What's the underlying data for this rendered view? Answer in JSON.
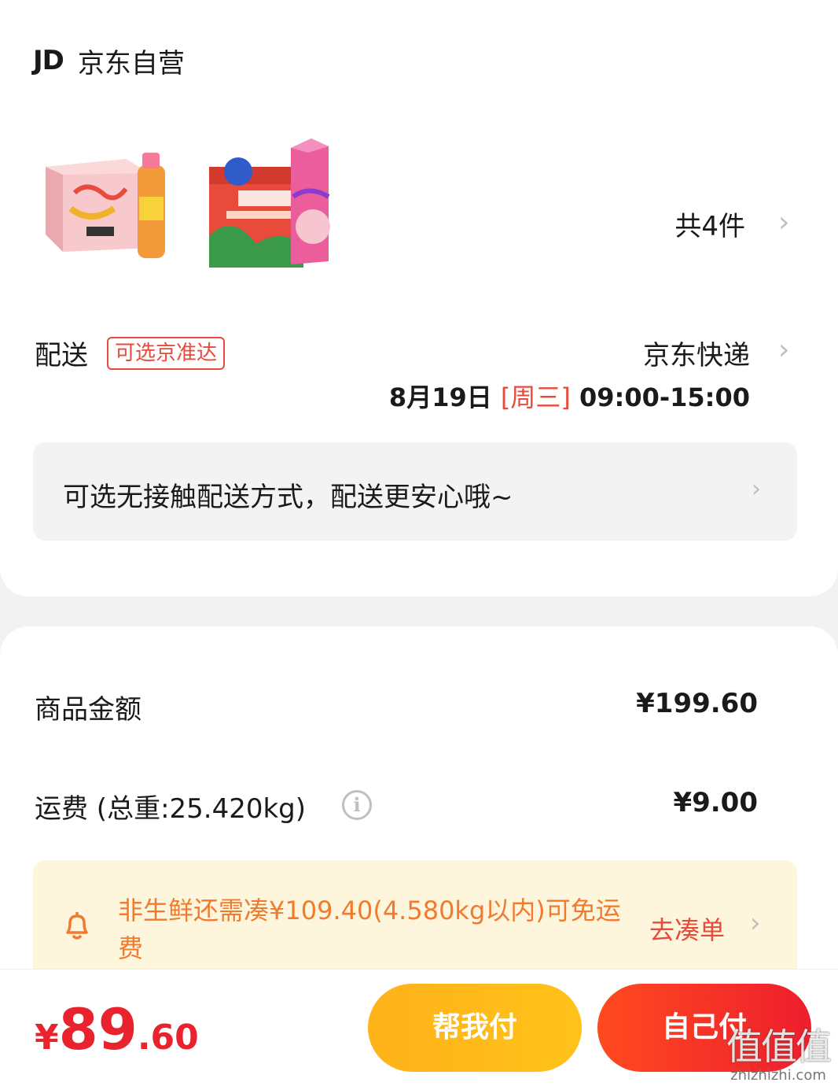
{
  "shop": {
    "logo": "JD",
    "name": "京东自营"
  },
  "products": {
    "count_text": "共4件",
    "items": [
      "peach-juice-case",
      "sagekey-juice-box"
    ]
  },
  "delivery": {
    "label": "配送",
    "tag": "可选京准达",
    "carrier": "京东快递",
    "date": "8月19日",
    "weekday": "[周三]",
    "time": "09:00-15:00"
  },
  "contactless": {
    "text": "可选无接触配送方式，配送更安心哦~"
  },
  "summary": {
    "goods_label": "商品金额",
    "goods_value": "¥199.60",
    "shipping_label": "运费 (总重:25.420kg)",
    "shipping_value": "¥9.00"
  },
  "notice": {
    "text": "非生鲜还需凑¥109.40(4.580kg以内)可免运费",
    "link": "去凑单"
  },
  "bottom": {
    "price_currency": "¥",
    "price_int": "89",
    "price_dec": ".60",
    "help_pay": "帮我付",
    "self_pay": "自己付"
  },
  "watermark": {
    "chars": "值值值",
    "url": "zhizhizhi.com"
  },
  "colors": {
    "accent_red": "#e84a3b",
    "price_red": "#e8232e",
    "notice_orange": "#f07b2e",
    "button_yellow": "#ffb21a"
  },
  "icons": [
    "chevron-right-icon",
    "info-icon",
    "bell-icon"
  ]
}
